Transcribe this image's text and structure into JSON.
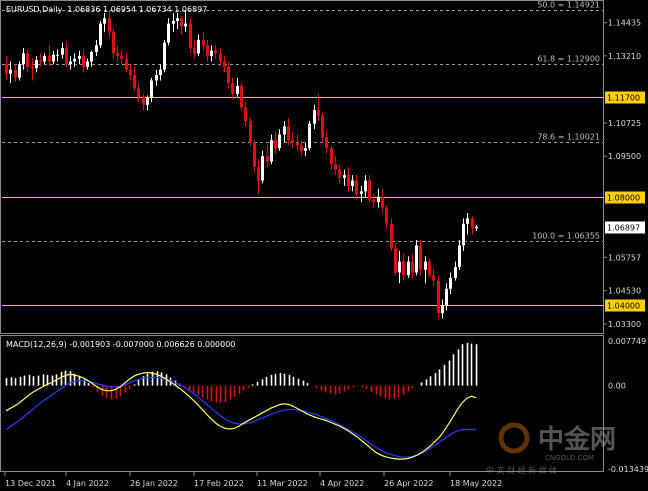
{
  "header": {
    "symbol": "EURUSD,Daily",
    "ohlc": "1.06836 1.06954 1.06734 1.06897"
  },
  "macd": {
    "label": "MACD(12,26,9) -0.001903 -0.007000 0.006626 0.000000",
    "axis": [
      "0.007749",
      "0.00",
      "-0.013439"
    ]
  },
  "price_axis": [
    "1.14435",
    "1.13210",
    "1.10725",
    "1.09500",
    "1.05757",
    "1.04530",
    "1.03300"
  ],
  "hlines": [
    {
      "price": 1.117,
      "label": "1.11700"
    },
    {
      "price": 1.08,
      "label": "1.08000"
    },
    {
      "price": 1.04,
      "label": "1.04000"
    }
  ],
  "fibs": [
    {
      "price": 1.14921,
      "label": "50.0 = 1.14921"
    },
    {
      "price": 1.129,
      "label": "61.8 = 1.12900"
    },
    {
      "price": 1.10021,
      "label": "78.6 = 1.10021"
    },
    {
      "price": 1.06355,
      "label": "100.0 = 1.06355"
    }
  ],
  "current_price": {
    "price": 1.06897,
    "label": "1.06897"
  },
  "x_labels": [
    "13 Dec 2021",
    "4 Jan 2022",
    "26 Jan 2022",
    "17 Feb 2022",
    "11 Mar 2022",
    "4 Apr 2022",
    "26 Apr 2022",
    "18 May 2022"
  ],
  "watermark": {
    "brand": "中金网",
    "domain": "CNGOLD.COM",
    "tagline": "中 文 财 经 新 媒 体"
  },
  "colors": {
    "bull": "#ffffff",
    "bear": "#e01010",
    "hline": "#ffd000",
    "fib": "#9a9a9a",
    "macd_main": "#ffff66",
    "macd_signal": "#2040ff",
    "hist_pos": "#ffffff",
    "hist_neg": "#e01010"
  },
  "chart_data": {
    "type": "candlestick",
    "price_range": [
      1.03,
      1.152
    ],
    "ohlc": [
      [
        1.129,
        1.132,
        1.1235,
        1.1255
      ],
      [
        1.1255,
        1.13,
        1.122,
        1.127
      ],
      [
        1.127,
        1.129,
        1.1225,
        1.124
      ],
      [
        1.124,
        1.13,
        1.123,
        1.129
      ],
      [
        1.129,
        1.135,
        1.127,
        1.133
      ],
      [
        1.133,
        1.1345,
        1.126,
        1.128
      ],
      [
        1.128,
        1.131,
        1.123,
        1.1275
      ],
      [
        1.1275,
        1.132,
        1.126,
        1.1305
      ],
      [
        1.1305,
        1.133,
        1.128,
        1.13
      ],
      [
        1.13,
        1.133,
        1.129,
        1.132
      ],
      [
        1.132,
        1.136,
        1.1285,
        1.13
      ],
      [
        1.13,
        1.134,
        1.129,
        1.1325
      ],
      [
        1.1325,
        1.1345,
        1.13,
        1.1325
      ],
      [
        1.1325,
        1.137,
        1.131,
        1.135
      ],
      [
        1.135,
        1.137,
        1.128,
        1.129
      ],
      [
        1.129,
        1.132,
        1.127,
        1.13
      ],
      [
        1.13,
        1.133,
        1.128,
        1.131
      ],
      [
        1.131,
        1.134,
        1.129,
        1.132
      ],
      [
        1.132,
        1.134,
        1.126,
        1.128
      ],
      [
        1.128,
        1.131,
        1.127,
        1.13
      ],
      [
        1.13,
        1.134,
        1.128,
        1.1335
      ],
      [
        1.1335,
        1.138,
        1.132,
        1.136
      ],
      [
        1.136,
        1.145,
        1.135,
        1.144
      ],
      [
        1.144,
        1.148,
        1.141,
        1.146
      ],
      [
        1.146,
        1.148,
        1.139,
        1.141
      ],
      [
        1.141,
        1.142,
        1.131,
        1.133
      ],
      [
        1.133,
        1.136,
        1.13,
        1.132
      ],
      [
        1.132,
        1.1345,
        1.129,
        1.131
      ],
      [
        1.131,
        1.133,
        1.126,
        1.127
      ],
      [
        1.127,
        1.129,
        1.123,
        1.125
      ],
      [
        1.125,
        1.128,
        1.119,
        1.12
      ],
      [
        1.12,
        1.122,
        1.115,
        1.117
      ],
      [
        1.117,
        1.118,
        1.112,
        1.114
      ],
      [
        1.114,
        1.1175,
        1.112,
        1.1165
      ],
      [
        1.1165,
        1.124,
        1.115,
        1.123
      ],
      [
        1.123,
        1.127,
        1.121,
        1.125
      ],
      [
        1.125,
        1.129,
        1.123,
        1.127
      ],
      [
        1.127,
        1.138,
        1.126,
        1.137
      ],
      [
        1.137,
        1.146,
        1.136,
        1.144
      ],
      [
        1.144,
        1.148,
        1.141,
        1.145
      ],
      [
        1.145,
        1.148,
        1.142,
        1.146
      ],
      [
        1.146,
        1.147,
        1.14,
        1.143
      ],
      [
        1.143,
        1.149,
        1.141,
        1.144
      ],
      [
        1.144,
        1.146,
        1.133,
        1.135
      ],
      [
        1.135,
        1.138,
        1.131,
        1.133
      ],
      [
        1.133,
        1.14,
        1.132,
        1.138
      ],
      [
        1.138,
        1.141,
        1.134,
        1.136
      ],
      [
        1.136,
        1.138,
        1.13,
        1.132
      ],
      [
        1.132,
        1.136,
        1.13,
        1.134
      ],
      [
        1.134,
        1.136,
        1.131,
        1.133
      ],
      [
        1.133,
        1.135,
        1.128,
        1.13
      ],
      [
        1.13,
        1.132,
        1.126,
        1.128
      ],
      [
        1.128,
        1.13,
        1.12,
        1.122
      ],
      [
        1.122,
        1.124,
        1.116,
        1.118
      ],
      [
        1.118,
        1.124,
        1.117,
        1.121
      ],
      [
        1.121,
        1.122,
        1.112,
        1.113
      ],
      [
        1.113,
        1.115,
        1.106,
        1.108
      ],
      [
        1.108,
        1.109,
        1.099,
        1.1
      ],
      [
        1.1,
        1.101,
        1.089,
        1.091
      ],
      [
        1.091,
        1.094,
        1.081,
        1.086
      ],
      [
        1.086,
        1.097,
        1.085,
        1.095
      ],
      [
        1.095,
        1.099,
        1.091,
        1.093
      ],
      [
        1.093,
        1.103,
        1.092,
        1.101
      ],
      [
        1.101,
        1.104,
        1.096,
        1.098
      ],
      [
        1.098,
        1.105,
        1.097,
        1.103
      ],
      [
        1.103,
        1.108,
        1.1,
        1.106
      ],
      [
        1.106,
        1.109,
        1.099,
        1.101
      ],
      [
        1.101,
        1.104,
        1.098,
        1.1
      ],
      [
        1.1,
        1.103,
        1.097,
        1.099
      ],
      [
        1.099,
        1.101,
        1.095,
        1.097
      ],
      [
        1.097,
        1.1,
        1.095,
        1.098
      ],
      [
        1.098,
        1.108,
        1.097,
        1.107
      ],
      [
        1.107,
        1.114,
        1.105,
        1.112
      ],
      [
        1.112,
        1.118,
        1.108,
        1.11
      ],
      [
        1.11,
        1.111,
        1.1,
        1.102
      ],
      [
        1.102,
        1.104,
        1.096,
        1.098
      ],
      [
        1.098,
        1.099,
        1.09,
        1.092
      ],
      [
        1.092,
        1.095,
        1.088,
        1.09
      ],
      [
        1.09,
        1.092,
        1.085,
        1.087
      ],
      [
        1.087,
        1.09,
        1.084,
        1.088
      ],
      [
        1.088,
        1.091,
        1.082,
        1.084
      ],
      [
        1.084,
        1.088,
        1.082,
        1.086
      ],
      [
        1.086,
        1.088,
        1.079,
        1.081
      ],
      [
        1.081,
        1.084,
        1.078,
        1.082
      ],
      [
        1.082,
        1.088,
        1.08,
        1.086
      ],
      [
        1.086,
        1.088,
        1.078,
        1.079
      ],
      [
        1.079,
        1.081,
        1.076,
        1.078
      ],
      [
        1.078,
        1.083,
        1.076,
        1.08
      ],
      [
        1.08,
        1.083,
        1.074,
        1.076
      ],
      [
        1.076,
        1.077,
        1.068,
        1.07
      ],
      [
        1.07,
        1.072,
        1.06,
        1.061
      ],
      [
        1.061,
        1.063,
        1.051,
        1.052
      ],
      [
        1.052,
        1.06,
        1.048,
        1.056
      ],
      [
        1.056,
        1.059,
        1.049,
        1.051
      ],
      [
        1.051,
        1.058,
        1.05,
        1.056
      ],
      [
        1.056,
        1.059,
        1.05,
        1.052
      ],
      [
        1.052,
        1.064,
        1.051,
        1.062
      ],
      [
        1.062,
        1.064,
        1.051,
        1.053
      ],
      [
        1.053,
        1.058,
        1.048,
        1.056
      ],
      [
        1.056,
        1.057,
        1.05,
        1.051
      ],
      [
        1.051,
        1.053,
        1.047,
        1.049
      ],
      [
        1.049,
        1.051,
        1.035,
        1.037
      ],
      [
        1.037,
        1.042,
        1.035,
        1.04
      ],
      [
        1.04,
        1.048,
        1.038,
        1.046
      ],
      [
        1.046,
        1.052,
        1.044,
        1.05
      ],
      [
        1.05,
        1.056,
        1.049,
        1.054
      ],
      [
        1.054,
        1.064,
        1.053,
        1.062
      ],
      [
        1.062,
        1.072,
        1.06,
        1.07
      ],
      [
        1.07,
        1.074,
        1.066,
        1.072
      ],
      [
        1.072,
        1.073,
        1.066,
        1.0684
      ],
      [
        1.06836,
        1.06954,
        1.06734,
        1.06897
      ]
    ],
    "macd_hist": [
      0.0012,
      0.0013,
      0.0012,
      0.0014,
      0.0016,
      0.0017,
      0.0015,
      0.0016,
      0.0018,
      0.0017,
      0.0016,
      0.0018,
      0.0022,
      0.0024,
      0.0023,
      0.0019,
      0.0015,
      0.001,
      0.0004,
      -0.0003,
      -0.001,
      -0.0016,
      -0.002,
      -0.0022,
      -0.0021,
      -0.0017,
      -0.0011,
      -0.0005,
      0.0002,
      0.0009,
      0.0015,
      0.0019,
      0.0022,
      0.0023,
      0.0021,
      0.0018,
      0.0013,
      0.0008,
      0.0003,
      -0.0003,
      -0.0007,
      -0.0011,
      -0.0015,
      -0.0019,
      -0.0022,
      -0.0025,
      -0.0027,
      -0.0028,
      -0.0026,
      -0.0022,
      -0.0018,
      -0.0013,
      -0.0008,
      -0.0003,
      0.0002,
      0.0006,
      0.001,
      0.0014,
      0.0017,
      0.0019,
      0.002,
      0.0019,
      0.0017,
      0.0014,
      0.0011,
      0.0008,
      0.0004,
      0.0,
      -0.0004,
      -0.0008,
      -0.0011,
      -0.0013,
      -0.0014,
      -0.0012,
      -0.0009,
      -0.0006,
      -0.0003,
      -0.0001,
      -0.0003,
      -0.0006,
      -0.001,
      -0.0014,
      -0.0017,
      -0.002,
      -0.0022,
      -0.0021,
      -0.0018,
      -0.0014,
      -0.0009,
      -0.0004,
      0.0,
      0.0005,
      0.001,
      0.0015,
      0.002,
      0.0026,
      0.0033,
      0.004,
      0.005,
      0.0058,
      0.0066,
      0.0068,
      0.0067,
      0.0066
    ],
    "macd_main": [
      -0.004,
      -0.0036,
      -0.0032,
      -0.0027,
      -0.0021,
      -0.0015,
      -0.001,
      -0.0006,
      -0.0002,
      0.0002,
      0.0005,
      0.0009,
      0.0013,
      0.0016,
      0.0018,
      0.0017,
      0.0015,
      0.0012,
      0.0008,
      0.0003,
      -0.0002,
      -0.0006,
      -0.0008,
      -0.0008,
      -0.0006,
      -0.0002,
      0.0004,
      0.001,
      0.0015,
      0.0018,
      0.002,
      0.0021,
      0.002,
      0.0018,
      0.0015,
      0.0011,
      0.0006,
      0.0001,
      -0.0004,
      -0.001,
      -0.0016,
      -0.0023,
      -0.003,
      -0.0038,
      -0.0046,
      -0.0053,
      -0.006,
      -0.0065,
      -0.0068,
      -0.0069,
      -0.0068,
      -0.0065,
      -0.006,
      -0.0056,
      -0.0052,
      -0.0048,
      -0.0044,
      -0.004,
      -0.0036,
      -0.0033,
      -0.003,
      -0.0029,
      -0.003,
      -0.0033,
      -0.0037,
      -0.0041,
      -0.0045,
      -0.0048,
      -0.0051,
      -0.0053,
      -0.0055,
      -0.0058,
      -0.0061,
      -0.0064,
      -0.0068,
      -0.0072,
      -0.0077,
      -0.0082,
      -0.0088,
      -0.0094,
      -0.01,
      -0.0106,
      -0.011,
      -0.0113,
      -0.0115,
      -0.0116,
      -0.0117,
      -0.0117,
      -0.0116,
      -0.0114,
      -0.0111,
      -0.0107,
      -0.0102,
      -0.0096,
      -0.0089,
      -0.0082,
      -0.0072,
      -0.0061,
      -0.0049,
      -0.0037,
      -0.0027,
      -0.002,
      -0.0017,
      -0.0019
    ],
    "macd_signal": [
      -0.007,
      -0.0065,
      -0.006,
      -0.0055,
      -0.0049,
      -0.0043,
      -0.0037,
      -0.0031,
      -0.0025,
      -0.002,
      -0.0015,
      -0.001,
      -0.0005,
      0.0,
      0.0004,
      0.0007,
      0.0008,
      0.0008,
      0.0007,
      0.0005,
      0.0003,
      0.0001,
      -0.0001,
      -0.0002,
      -0.0002,
      -0.0001,
      0.0001,
      0.0004,
      0.0007,
      0.001,
      0.0012,
      0.0013,
      0.0013,
      0.0013,
      0.0012,
      0.001,
      0.0008,
      0.0005,
      0.0002,
      -0.0002,
      -0.0007,
      -0.0012,
      -0.0018,
      -0.0024,
      -0.003,
      -0.0036,
      -0.0042,
      -0.0048,
      -0.0053,
      -0.0057,
      -0.006,
      -0.0061,
      -0.0061,
      -0.006,
      -0.0058,
      -0.0055,
      -0.0052,
      -0.0049,
      -0.0046,
      -0.0043,
      -0.0041,
      -0.0039,
      -0.0038,
      -0.0038,
      -0.0039,
      -0.004,
      -0.0042,
      -0.0044,
      -0.0046,
      -0.0049,
      -0.0052,
      -0.0055,
      -0.0058,
      -0.0062,
      -0.0066,
      -0.007,
      -0.0074,
      -0.0078,
      -0.0083,
      -0.0088,
      -0.0093,
      -0.0098,
      -0.0102,
      -0.0106,
      -0.0109,
      -0.0111,
      -0.0113,
      -0.0114,
      -0.0114,
      -0.0113,
      -0.0111,
      -0.0108,
      -0.0104,
      -0.01,
      -0.0095,
      -0.009,
      -0.0085,
      -0.008,
      -0.0075,
      -0.0072,
      -0.007,
      -0.007,
      -0.007,
      -0.007
    ],
    "macd_range": [
      -0.013439,
      0.007749
    ]
  }
}
